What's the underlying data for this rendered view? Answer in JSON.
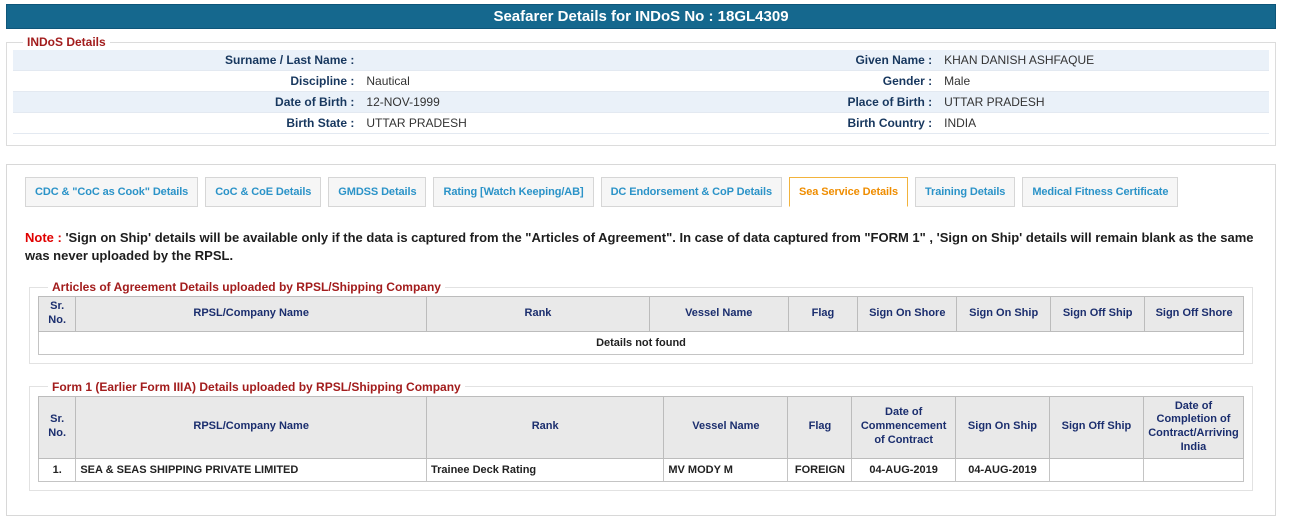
{
  "header": {
    "title": "Seafarer Details for INDoS No : 18GL4309"
  },
  "indos": {
    "legend": "INDoS Details",
    "rows": [
      {
        "l1": "Surname / Last Name :",
        "v1": "",
        "l2": "Given Name :",
        "v2": "KHAN DANISH ASHFAQUE"
      },
      {
        "l1": "Discipline :",
        "v1": "Nautical",
        "l2": "Gender :",
        "v2": "Male"
      },
      {
        "l1": "Date of Birth :",
        "v1": "12-NOV-1999",
        "l2": "Place of Birth :",
        "v2": "UTTAR PRADESH"
      },
      {
        "l1": "Birth State :",
        "v1": "UTTAR PRADESH",
        "l2": "Birth Country :",
        "v2": "INDIA"
      }
    ]
  },
  "tabs": [
    {
      "label": "CDC & \"CoC as Cook\" Details",
      "active": false
    },
    {
      "label": "CoC & CoE Details",
      "active": false
    },
    {
      "label": "GMDSS Details",
      "active": false
    },
    {
      "label": "Rating [Watch Keeping/AB]",
      "active": false
    },
    {
      "label": "DC Endorsement & CoP Details",
      "active": false
    },
    {
      "label": "Sea Service Details",
      "active": true
    },
    {
      "label": "Training Details",
      "active": false
    },
    {
      "label": "Medical Fitness Certificate",
      "active": false
    }
  ],
  "note": {
    "prefix": "Note :",
    "text": "'Sign on Ship' details will be available only if the data is captured from the \"Articles of Agreement\". In case of data captured from \"FORM 1\" , 'Sign on Ship' details will remain blank as the same was never uploaded by the RPSL."
  },
  "articles": {
    "legend": "Articles of Agreement Details uploaded by RPSL/Shipping Company",
    "headers": [
      "Sr. No.",
      "RPSL/Company Name",
      "Rank",
      "Vessel Name",
      "Flag",
      "Sign On Shore",
      "Sign On Ship",
      "Sign Off Ship",
      "Sign Off Shore"
    ],
    "empty_message": "Details not found"
  },
  "form1": {
    "legend": "Form 1 (Earlier Form IIIA) Details uploaded by RPSL/Shipping Company",
    "headers": [
      "Sr. No.",
      "RPSL/Company Name",
      "Rank",
      "Vessel Name",
      "Flag",
      "Date of Commencement of Contract",
      "Sign On Ship",
      "Sign Off Ship",
      "Date of Completion of Contract/Arriving India"
    ],
    "rows": [
      [
        "1.",
        "SEA & SEAS SHIPPING PRIVATE LIMITED",
        "Trainee Deck Rating",
        "MV MODY M",
        "FOREIGN",
        "04-AUG-2019",
        "04-AUG-2019",
        "",
        ""
      ]
    ]
  },
  "colors": {
    "header_bar": "#15688e",
    "legend_red": "#a21c1c",
    "label_navy": "#17375e",
    "table_header_navy": "#1b2e6e",
    "tab_blue": "#2b93c8",
    "active_tab_orange": "#ef8d00",
    "active_tab_border": "#f2b33d",
    "note_red": "#e00000",
    "row_alt_blue": "#eaf1f9"
  }
}
